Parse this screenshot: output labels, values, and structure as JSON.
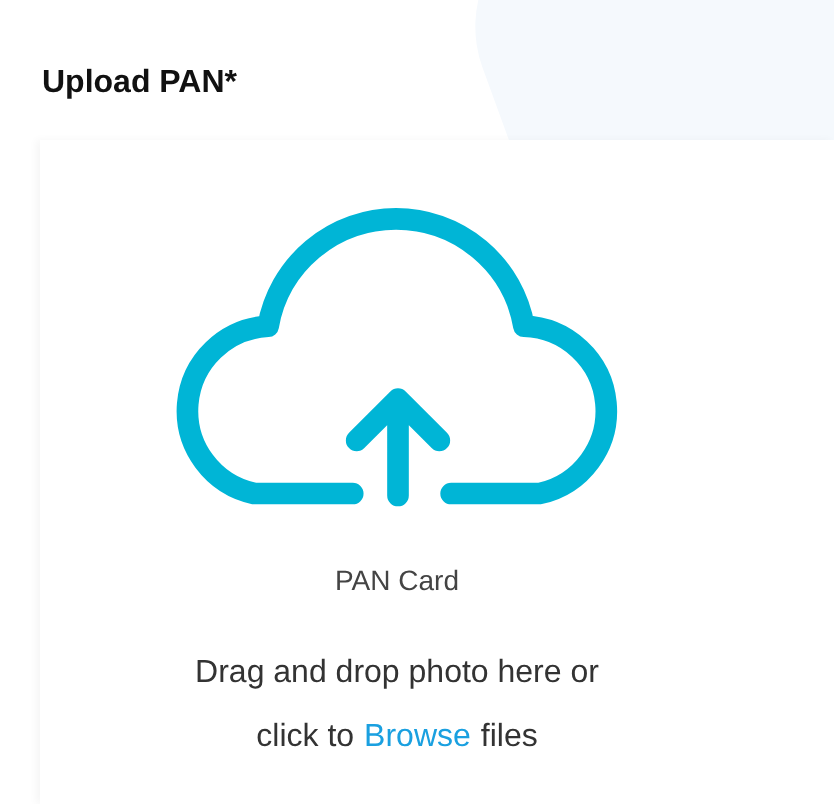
{
  "title": "Upload PAN*",
  "upload": {
    "caption": "PAN Card",
    "line_1": "Drag and drop photo here or",
    "line_2_before": "click to",
    "link": "Browse",
    "line_2_after": "files"
  }
}
